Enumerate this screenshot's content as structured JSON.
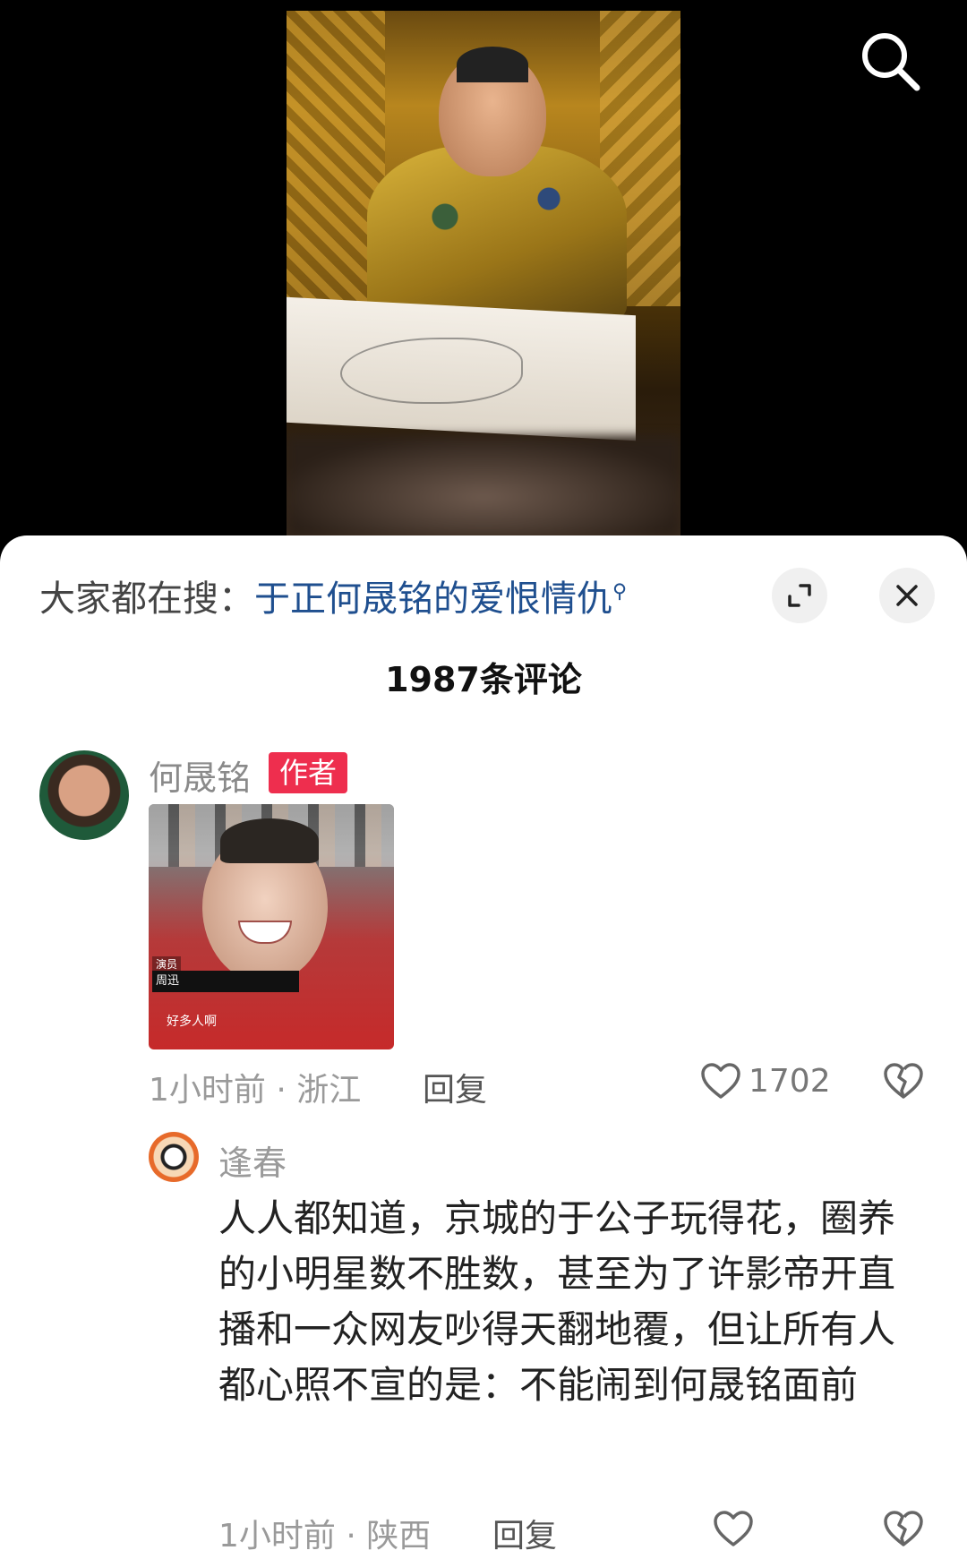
{
  "search_bar": {
    "prefix": "大家都在搜：",
    "query": "于正何晟铭的爱恨情仇",
    "search_icon": "magnifier-icon"
  },
  "header": {
    "comment_count": "1987条评论",
    "expand_icon": "expand-icon",
    "close_icon": "close-icon"
  },
  "comments": [
    {
      "username": "何晟铭",
      "badge": "作者",
      "image_labels": [
        "演员",
        "周迅",
        "好多人啊"
      ],
      "time_location": "1小时前 · 浙江",
      "reply_label": "回复",
      "likes": "1702"
    },
    {
      "username": "逢春",
      "text": "人人都知道，京城的于公子玩得花，圈养的小明星数不胜数，甚至为了许影帝开直播和一众网友吵得天翻地覆，但让所有人都心照不宣的是：不能闹到何晟铭面前",
      "time_location": "1小时前 · 陕西",
      "reply_label": "回复"
    }
  ],
  "colors": {
    "accent_link": "#1f4f8f",
    "badge_red": "#ee2e4e",
    "sheet_bg": "#ffffff",
    "page_bg": "#000000"
  }
}
